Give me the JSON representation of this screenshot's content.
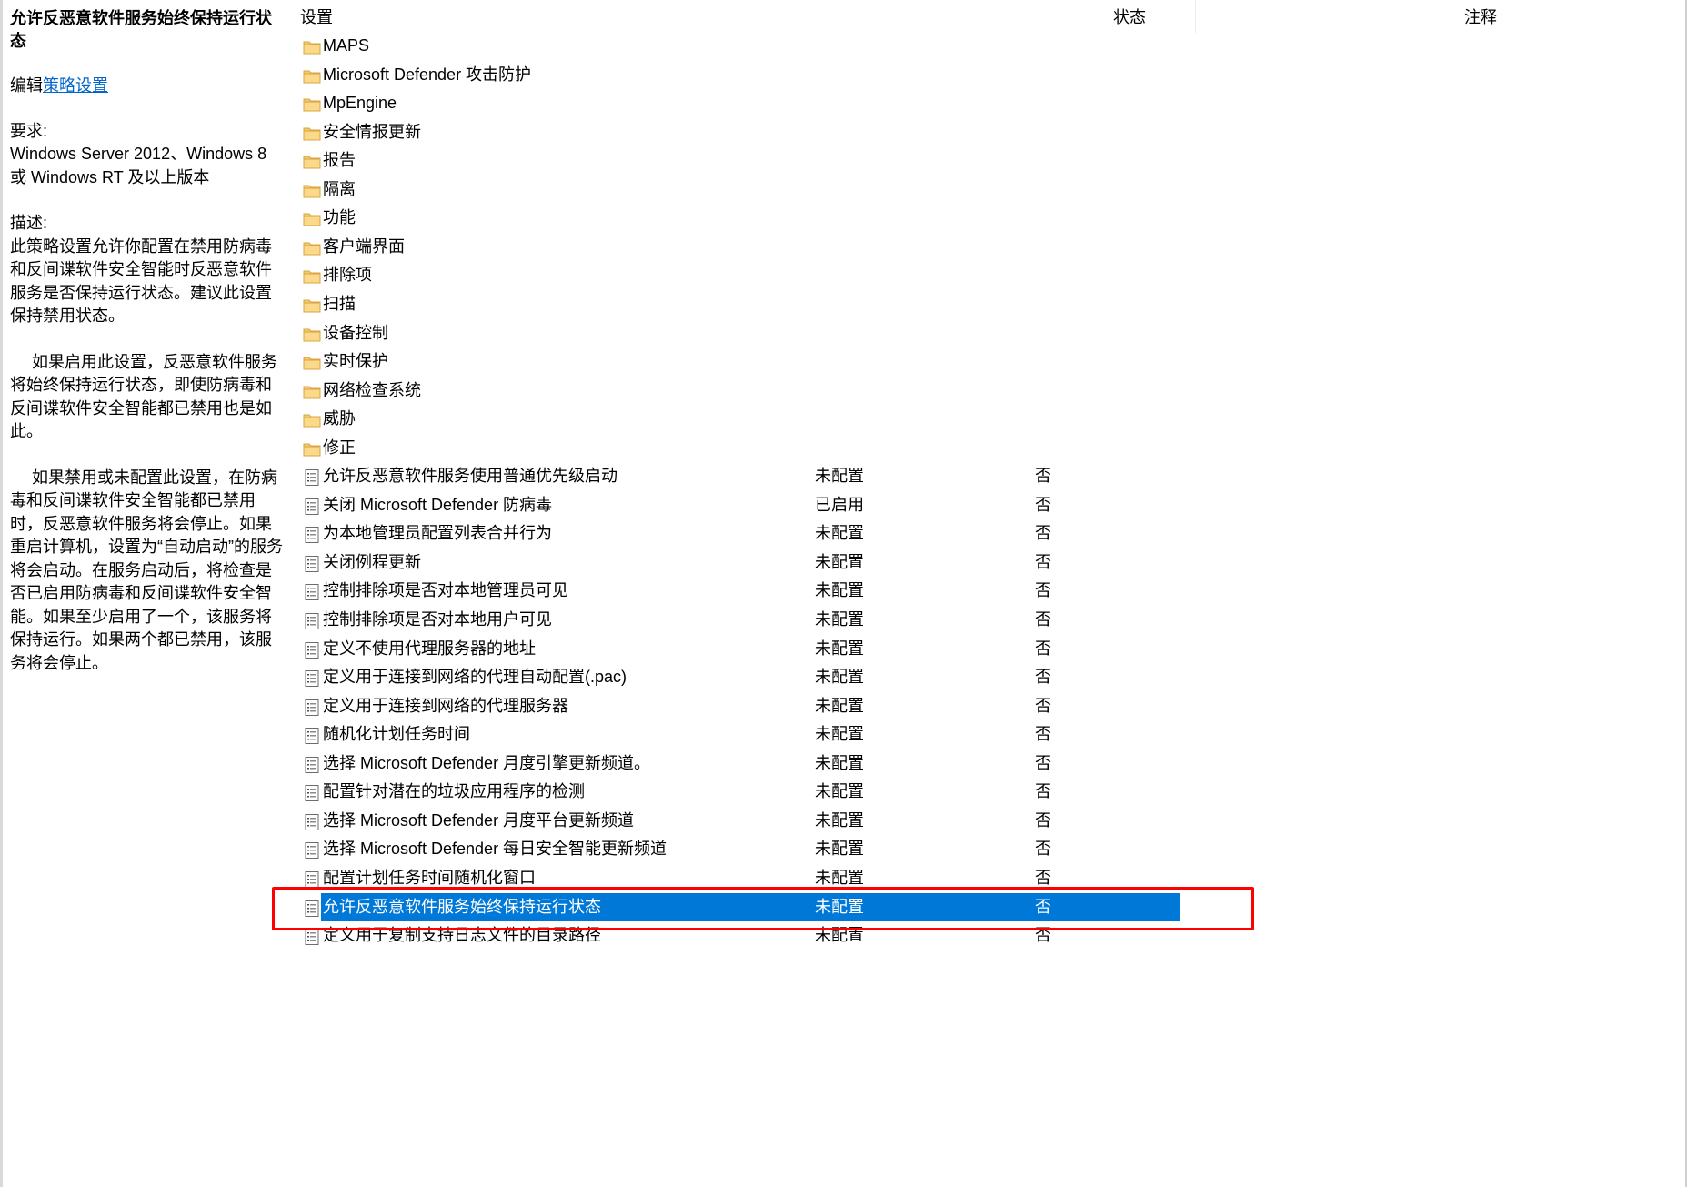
{
  "description": {
    "title": "允许反恶意软件服务始终保持运行状态",
    "edit_prefix": "编辑",
    "edit_link": "策略设置",
    "requirements_label": "要求:",
    "requirements_text": "Windows Server 2012、Windows 8 或 Windows RT 及以上版本",
    "description_label": "描述:",
    "paragraph_1": "此策略设置允许你配置在禁用防病毒和反间谍软件安全智能时反恶意软件服务是否保持运行状态。建议此设置保持禁用状态。",
    "paragraph_2": "如果启用此设置，反恶意软件服务将始终保持运行状态，即使防病毒和反间谍软件安全智能都已禁用也是如此。",
    "paragraph_3": "如果禁用或未配置此设置，在防病毒和反间谍软件安全智能都已禁用时，反恶意软件服务将会停止。如果重启计算机，设置为“自动启动”的服务将会启动。在服务启动后，将检查是否已启用防病毒和反间谍软件安全智能。如果至少启用了一个，该服务将保持运行。如果两个都已禁用，该服务将会停止。"
  },
  "columns": {
    "setting": "设置",
    "state": "状态",
    "comment": "注释"
  },
  "folders": [
    {
      "label": "MAPS"
    },
    {
      "label": "Microsoft Defender 攻击防护"
    },
    {
      "label": "MpEngine"
    },
    {
      "label": "安全情报更新"
    },
    {
      "label": "报告"
    },
    {
      "label": "隔离"
    },
    {
      "label": "功能"
    },
    {
      "label": "客户端界面"
    },
    {
      "label": "排除项"
    },
    {
      "label": "扫描"
    },
    {
      "label": "设备控制"
    },
    {
      "label": "实时保护"
    },
    {
      "label": "网络检查系统"
    },
    {
      "label": "威胁"
    },
    {
      "label": "修正"
    }
  ],
  "policies": [
    {
      "label": "允许反恶意软件服务使用普通优先级启动",
      "state": "未配置",
      "comment": "否"
    },
    {
      "label": "关闭 Microsoft Defender 防病毒",
      "state": "已启用",
      "comment": "否"
    },
    {
      "label": "为本地管理员配置列表合并行为",
      "state": "未配置",
      "comment": "否"
    },
    {
      "label": "关闭例程更新",
      "state": "未配置",
      "comment": "否"
    },
    {
      "label": "控制排除项是否对本地管理员可见",
      "state": "未配置",
      "comment": "否"
    },
    {
      "label": "控制排除项是否对本地用户可见",
      "state": "未配置",
      "comment": "否"
    },
    {
      "label": "定义不使用代理服务器的地址",
      "state": "未配置",
      "comment": "否"
    },
    {
      "label": "定义用于连接到网络的代理自动配置(.pac)",
      "state": "未配置",
      "comment": "否"
    },
    {
      "label": "定义用于连接到网络的代理服务器",
      "state": "未配置",
      "comment": "否"
    },
    {
      "label": "随机化计划任务时间",
      "state": "未配置",
      "comment": "否"
    },
    {
      "label": "选择 Microsoft Defender 月度引擎更新频道。",
      "state": "未配置",
      "comment": "否"
    },
    {
      "label": "配置针对潜在的垃圾应用程序的检测",
      "state": "未配置",
      "comment": "否"
    },
    {
      "label": "选择 Microsoft Defender 月度平台更新频道",
      "state": "未配置",
      "comment": "否"
    },
    {
      "label": "选择 Microsoft Defender 每日安全智能更新频道",
      "state": "未配置",
      "comment": "否"
    },
    {
      "label": "配置计划任务时间随机化窗口",
      "state": "未配置",
      "comment": "否"
    },
    {
      "label": "允许反恶意软件服务始终保持运行状态",
      "state": "未配置",
      "comment": "否",
      "selected": true
    },
    {
      "label": "定义用于复制支持日志文件的目录路径",
      "state": "未配置",
      "comment": "否"
    }
  ],
  "colors": {
    "selection": "#0078d7",
    "highlight_border": "#ff0000",
    "folder": "#f5c96b",
    "link": "#0066cc"
  },
  "icons": {
    "folder": "folder-icon",
    "policy": "policy-setting-icon"
  }
}
